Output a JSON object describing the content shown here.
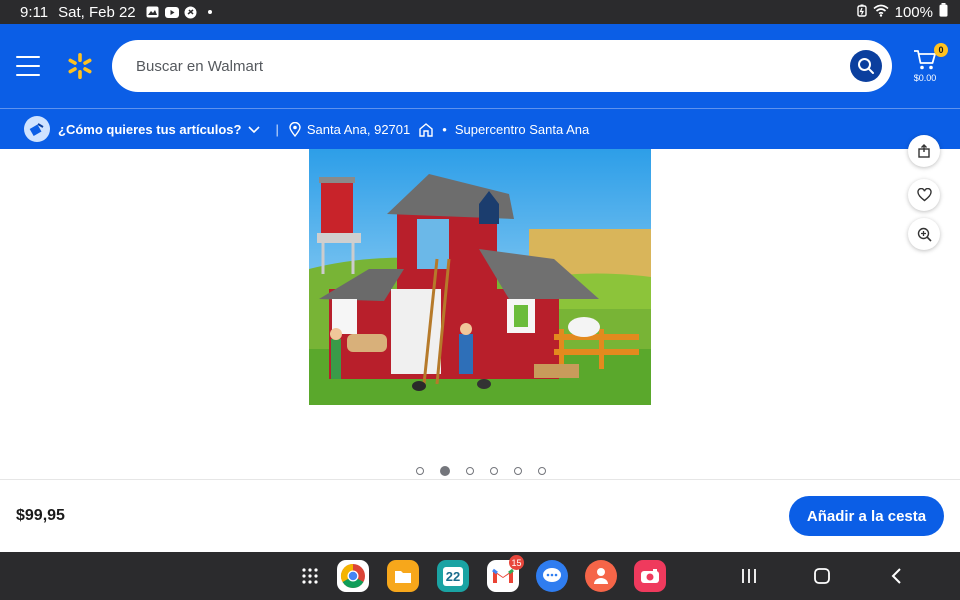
{
  "status_bar": {
    "time": "9:11",
    "date": "Sat, Feb 22",
    "battery": "100%"
  },
  "header": {
    "search_placeholder": "Buscar en Walmart",
    "cart_count": "0",
    "cart_amount": "$0.00",
    "colors": {
      "primary": "#0b5ee6",
      "spark": "#ffc220",
      "search_button": "#0b3f9e"
    }
  },
  "subheader": {
    "question": "¿Cómo quieres tus artículos?",
    "location": "Santa Ana, 92701",
    "store": "Supercentro Santa Ana"
  },
  "gallery": {
    "total_images": 6,
    "active_index": 1
  },
  "buy_bar": {
    "price": "$99,95",
    "add_button_label": "Añadir a la cesta"
  },
  "nav_bar": {
    "calendar_day": "22",
    "gmail_badge": "15"
  },
  "icons": [
    "menu-icon",
    "walmart-spark-icon",
    "search-icon",
    "cart-icon",
    "delivery-icon",
    "chevron-down-icon",
    "location-pin-icon",
    "store-icon",
    "share-icon",
    "heart-icon",
    "zoom-icon"
  ]
}
